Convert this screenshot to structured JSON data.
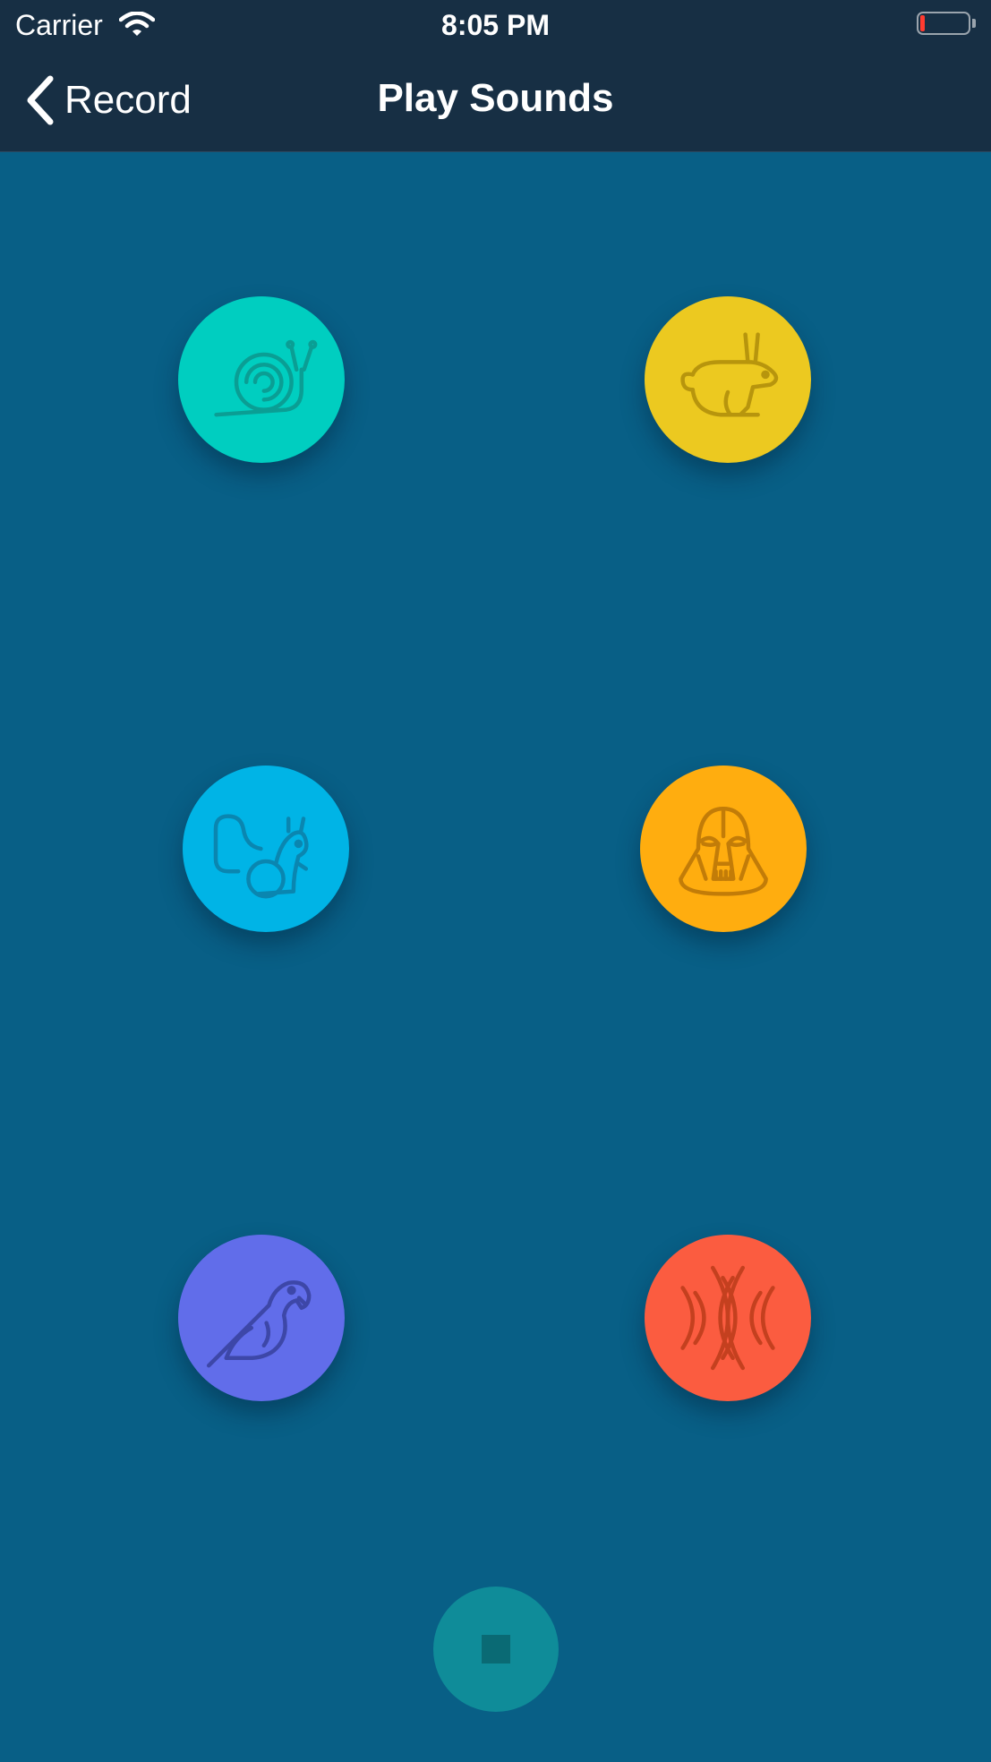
{
  "status_bar": {
    "carrier": "Carrier",
    "time": "8:05 PM",
    "battery_level": 0.1,
    "battery_color": "#ff3b30"
  },
  "nav_bar": {
    "back_label": "Record",
    "title": "Play Sounds"
  },
  "sound_buttons": [
    {
      "icon": "snail-icon",
      "color": "#00cec0"
    },
    {
      "icon": "rabbit-icon",
      "color": "#ecc920"
    },
    {
      "icon": "chipmunk-icon",
      "color": "#00b4e6"
    },
    {
      "icon": "darth-vader-icon",
      "color": "#ffad0f"
    },
    {
      "icon": "parrot-icon",
      "color": "#616dea"
    },
    {
      "icon": "reverb-icon",
      "color": "#fb5c40"
    }
  ],
  "stop_button": {
    "icon": "stop-icon",
    "color": "#0f8c99"
  }
}
